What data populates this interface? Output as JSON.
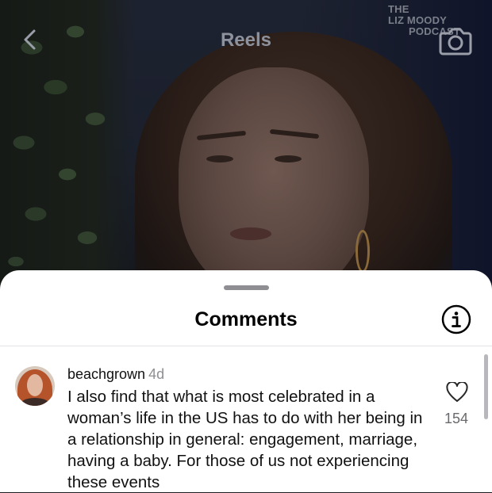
{
  "topbar": {
    "back_icon": "chevron-left-icon",
    "title": "Reels",
    "watermark": {
      "line1": "THE",
      "line2": "LIZ MOODY",
      "line3": "PODCAST"
    },
    "camera_icon": "camera-icon"
  },
  "comments_sheet": {
    "title": "Comments",
    "info_icon": "info-icon",
    "comments": [
      {
        "username": "beachgrown",
        "time": "4d",
        "text": "I also find that what is most celebrated in a woman’s life in the US has to do with her being in a relationship in general: engagement, marriage, having a baby. For those of us not experiencing these events",
        "likes": "154",
        "like_icon": "heart-outline-icon"
      }
    ]
  }
}
